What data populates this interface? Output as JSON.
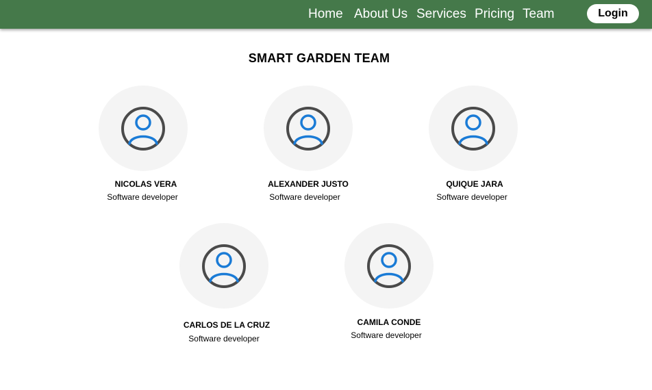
{
  "nav": {
    "links": [
      "Home",
      "About Us",
      "Services",
      "Pricing",
      "Team"
    ],
    "login_label": "Login"
  },
  "page": {
    "title": "SMART GARDEN TEAM"
  },
  "team": [
    {
      "name": "NICOLAS VERA",
      "role": "Software developer"
    },
    {
      "name": "ALEXANDER JUSTO",
      "role": "Software developer"
    },
    {
      "name": "QUIQUE JARA",
      "role": "Software developer"
    },
    {
      "name": "CARLOS DE LA CRUZ",
      "role": "Software developer"
    },
    {
      "name": "CAMILA CONDE",
      "role": "Software developer"
    }
  ],
  "colors": {
    "navbar": "#45794a",
    "avatar_bg": "#f4f4f4",
    "icon_ring": "#4a4a4a",
    "icon_person": "#1a7bd6"
  },
  "icons": {
    "avatar": "user-circle-icon"
  }
}
